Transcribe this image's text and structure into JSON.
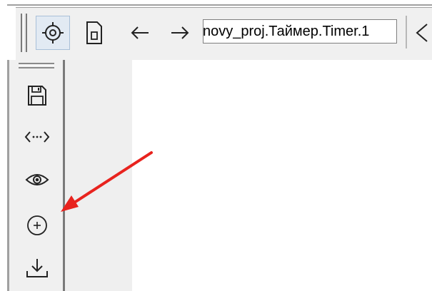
{
  "toolbar": {
    "path_field": {
      "value": "novy_proj.Таймер.Timer.1"
    },
    "buttons": [
      {
        "icon": "target-icon",
        "active": true
      },
      {
        "icon": "document-icon"
      },
      {
        "icon": "arrow-left-icon"
      },
      {
        "icon": "arrow-right-icon"
      },
      {
        "icon": "chevron-left-icon"
      }
    ]
  },
  "sidebar": {
    "buttons": [
      {
        "icon": "save-icon"
      },
      {
        "icon": "code-icon"
      },
      {
        "icon": "eye-icon"
      },
      {
        "icon": "add-circle-icon"
      },
      {
        "icon": "download-icon"
      }
    ]
  },
  "annotation": {
    "color": "#e8231e",
    "points_to": "add-circle-icon"
  },
  "colors": {
    "panel": "#f0f0f0",
    "active_button": "#e2eaf3",
    "canvas": "#ffffff"
  }
}
